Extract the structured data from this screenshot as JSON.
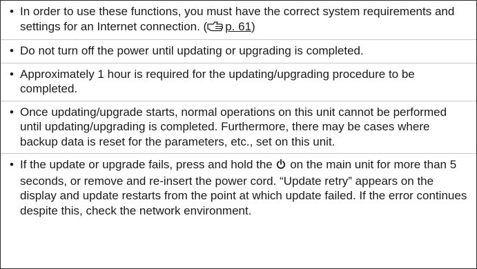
{
  "notices": {
    "item1": {
      "text": "In order to use these functions, you must have the correct system requirements and settings for an Internet connection.",
      "open_paren": " (",
      "ref_icon": "pointing-hand-icon",
      "page_ref": "p. 61",
      "close_paren": ")"
    },
    "item2": {
      "text": "Do not turn off the power until updating or upgrading is completed."
    },
    "item3": {
      "text": "Approximately 1 hour is required for the updating/upgrading procedure to be completed."
    },
    "item4": {
      "text": "Once updating/upgrade starts, normal operations on this unit cannot be performed until updating/upgrading is completed. Furthermore, there may be cases where backup data is reset for the parameters, etc., set on this unit."
    },
    "item5": {
      "text_before": "If the update or upgrade fails, press and hold the",
      "power_icon": "power-icon",
      "text_after": "on the main unit for more than 5 seconds, or remove and re-insert the power cord. “Update retry” appears on the display and update restarts from the point at which update failed. If the error continues despite this, check the network environment."
    }
  }
}
